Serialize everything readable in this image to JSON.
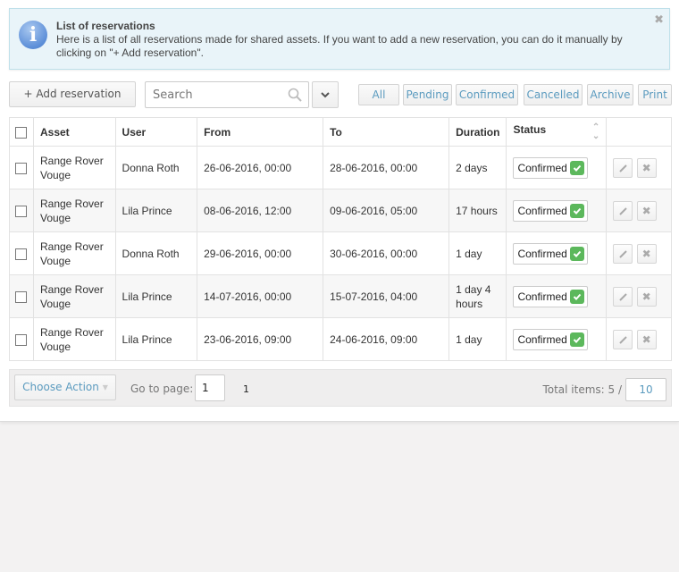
{
  "info": {
    "icon": "info-icon",
    "title": "List of reservations",
    "text": "Here is a list of all reservations made for shared assets. If you want to add a new reservation, you can do it manually by clicking on \"+ Add reservation\".",
    "close_glyph": "✖"
  },
  "toolbar": {
    "add_label": "+ Add reservation",
    "search_placeholder": "Search",
    "search_value": "",
    "filters": [
      "All",
      "Pending",
      "Confirmed",
      "Cancelled",
      "Archive",
      "Print"
    ]
  },
  "table": {
    "columns": [
      "Asset",
      "User",
      "From",
      "To",
      "Duration",
      "Status"
    ],
    "rows": [
      {
        "asset": "Range Rover Vouge",
        "user": "Donna Roth",
        "from": "26-06-2016, 00:00",
        "to": "28-06-2016, 00:00",
        "duration": "2 days",
        "status": "Confirmed"
      },
      {
        "asset": "Range Rover Vouge",
        "user": "Lila Prince",
        "from": "08-06-2016, 12:00",
        "to": "09-06-2016, 05:00",
        "duration": "17 hours",
        "status": "Confirmed"
      },
      {
        "asset": "Range Rover Vouge",
        "user": "Donna Roth",
        "from": "29-06-2016, 00:00",
        "to": "30-06-2016, 00:00",
        "duration": "1 day",
        "status": "Confirmed"
      },
      {
        "asset": "Range Rover Vouge",
        "user": "Lila Prince",
        "from": "14-07-2016, 00:00",
        "to": "15-07-2016, 04:00",
        "duration": "1 day 4 hours",
        "status": "Confirmed"
      },
      {
        "asset": "Range Rover Vouge",
        "user": "Lila Prince",
        "from": "23-06-2016, 09:00",
        "to": "24-06-2016, 09:00",
        "duration": "1 day",
        "status": "Confirmed"
      }
    ]
  },
  "footer": {
    "choose_action": "Choose Action",
    "goto_label": "Go to page:",
    "goto_value": "1",
    "pages": [
      "1"
    ],
    "total_label": "Total items: 5 /",
    "per_page": "10"
  },
  "colors": {
    "accent": "#5b9bbf",
    "success": "#5cb85c",
    "info_bg": "#e9f4f9"
  }
}
